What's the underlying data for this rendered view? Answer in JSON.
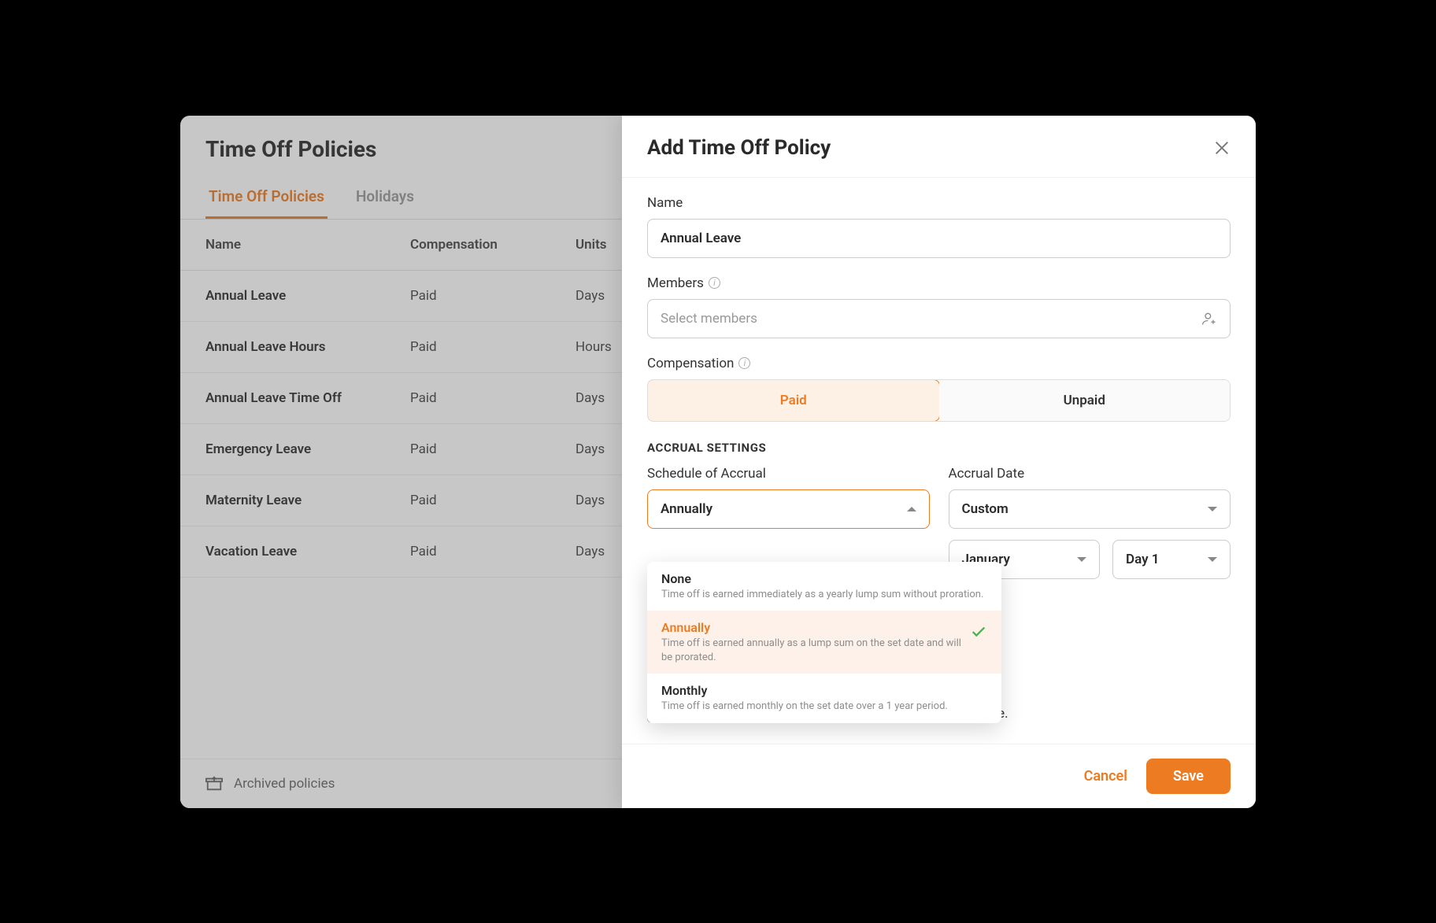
{
  "page": {
    "title": "Time Off Policies"
  },
  "tabs": [
    {
      "label": "Time Off Policies",
      "active": true
    },
    {
      "label": "Holidays",
      "active": false
    }
  ],
  "table": {
    "headers": {
      "name": "Name",
      "compensation": "Compensation",
      "units": "Units"
    },
    "rows": [
      {
        "name": "Annual Leave",
        "compensation": "Paid",
        "units": "Days"
      },
      {
        "name": "Annual Leave Hours",
        "compensation": "Paid",
        "units": "Hours"
      },
      {
        "name": "Annual Leave Time Off",
        "compensation": "Paid",
        "units": "Days"
      },
      {
        "name": "Emergency Leave",
        "compensation": "Paid",
        "units": "Days"
      },
      {
        "name": "Maternity Leave",
        "compensation": "Paid",
        "units": "Days"
      },
      {
        "name": "Vacation Leave",
        "compensation": "Paid",
        "units": "Days"
      }
    ]
  },
  "archived": {
    "label": "Archived policies"
  },
  "modal": {
    "title": "Add Time Off Policy",
    "fields": {
      "name_label": "Name",
      "name_value": "Annual Leave",
      "members_label": "Members",
      "members_placeholder": "Select members",
      "compensation_label": "Compensation",
      "compensation_options": {
        "paid": "Paid",
        "unpaid": "Unpaid"
      },
      "accrual_section": "ACCRUAL SETTINGS",
      "schedule_label": "Schedule of Accrual",
      "schedule_value": "Annually",
      "accrual_date_label": "Accrual Date",
      "accrual_date_value": "Custom",
      "month_value": "January",
      "day_value": "Day 1",
      "carry_forward_label": "Leave balances can be carried forward to the next cycle."
    },
    "schedule_options": [
      {
        "title": "None",
        "desc": "Time off is earned immediately as a yearly lump sum without proration.",
        "selected": false
      },
      {
        "title": "Annually",
        "desc": "Time off is earned annually as a lump sum on the set date and will be prorated.",
        "selected": true
      },
      {
        "title": "Monthly",
        "desc": "Time off is earned monthly on the set date over a 1 year period.",
        "selected": false
      }
    ],
    "footer": {
      "cancel": "Cancel",
      "save": "Save"
    }
  }
}
